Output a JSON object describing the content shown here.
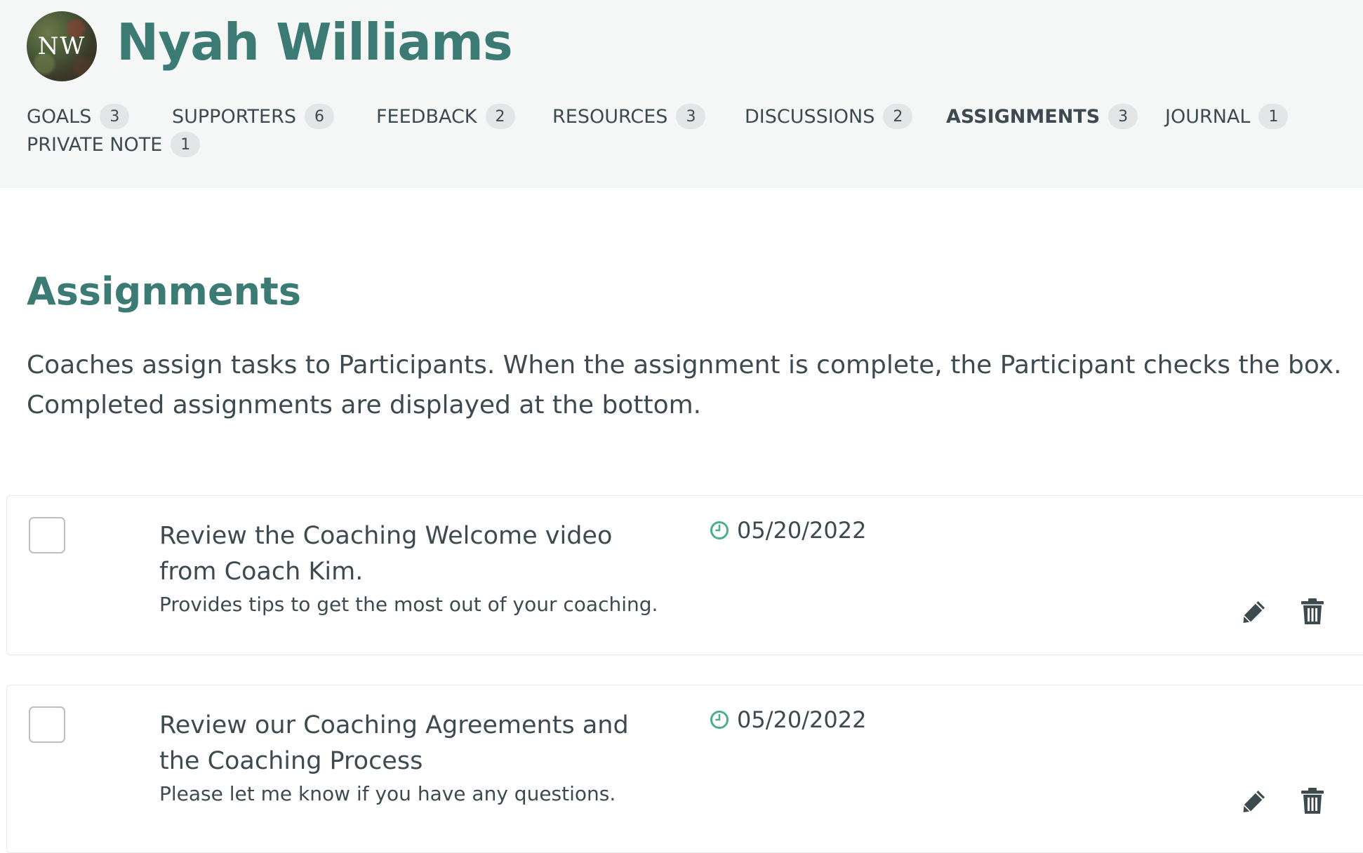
{
  "user": {
    "initials": "NW",
    "name": "Nyah Williams"
  },
  "nav": {
    "items": [
      {
        "label": "GOALS",
        "count": "3"
      },
      {
        "label": "SUPPORTERS",
        "count": "6"
      },
      {
        "label": "FEEDBACK",
        "count": "2"
      },
      {
        "label": "RESOURCES",
        "count": "3"
      },
      {
        "label": "DISCUSSIONS",
        "count": "2"
      },
      {
        "label": "ASSIGNMENTS",
        "count": "3"
      },
      {
        "label": "JOURNAL",
        "count": "1"
      },
      {
        "label": "PRIVATE NOTE",
        "count": "1"
      }
    ],
    "active": "ASSIGNMENTS"
  },
  "main": {
    "title": "Assignments",
    "description": "Coaches assign tasks to Participants. When the assignment is complete, the Participant checks the box. Completed assignments are displayed at the bottom."
  },
  "assignments": [
    {
      "title": "Review the Coaching Welcome video from Coach Kim.",
      "description": "Provides tips to get the most out of your coaching.",
      "due_date": "05/20/2022",
      "completed": false
    },
    {
      "title": "Review our Coaching Agreements and the Coaching Process",
      "description": "Please let me know if you have any questions.",
      "due_date": "05/20/2022",
      "completed": false
    }
  ],
  "icons": {
    "clock": "clock-icon",
    "edit": "pencil-icon",
    "delete": "trash-icon"
  },
  "colors": {
    "brand": "#3b7b74",
    "header_bg": "#f5f6f6",
    "badge_bg": "#e3e6e7",
    "clock_green": "#4caf87"
  }
}
